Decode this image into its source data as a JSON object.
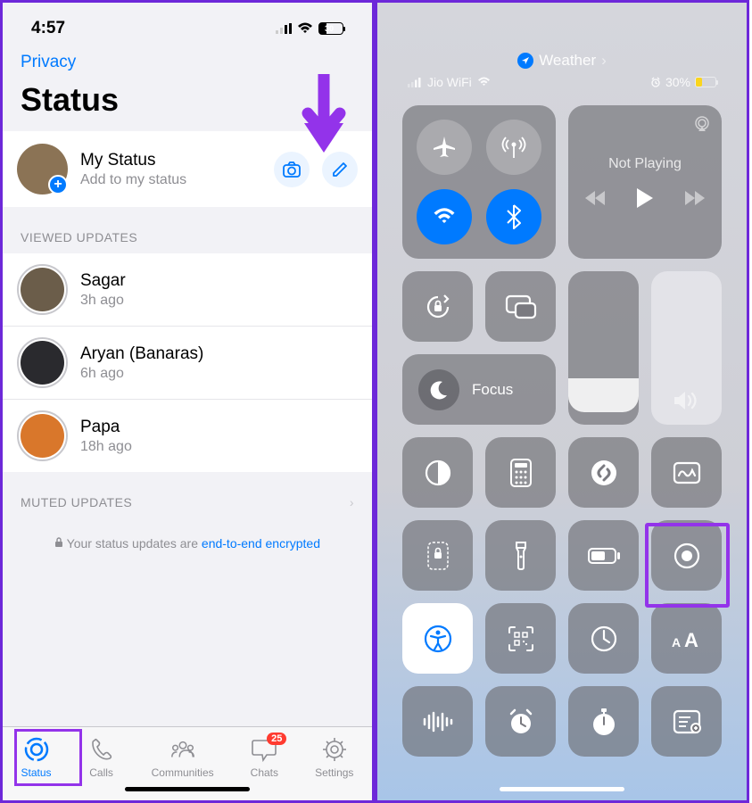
{
  "left": {
    "time": "4:57",
    "battery": "30",
    "privacy": "Privacy",
    "title": "Status",
    "myStatus": {
      "title": "My Status",
      "sub": "Add to my status"
    },
    "sectionViewed": "VIEWED UPDATES",
    "updates": [
      {
        "name": "Sagar",
        "time": "3h ago"
      },
      {
        "name": "Aryan (Banaras)",
        "time": "6h ago"
      },
      {
        "name": "Papa",
        "time": "18h ago"
      }
    ],
    "sectionMuted": "MUTED UPDATES",
    "encrypt_prefix": "Your status updates are ",
    "encrypt_link": "end-to-end encrypted",
    "tabs": {
      "status": "Status",
      "calls": "Calls",
      "communities": "Communities",
      "chats": "Chats",
      "settings": "Settings",
      "chatBadge": "25"
    }
  },
  "right": {
    "weather": "Weather",
    "carrier": "Jio WiFi",
    "battery": "30%",
    "media": {
      "title": "Not Playing"
    },
    "focus": "Focus"
  },
  "colors": {
    "accent": "#007aff",
    "highlight": "#9333ea",
    "badge": "#ff3b30"
  }
}
